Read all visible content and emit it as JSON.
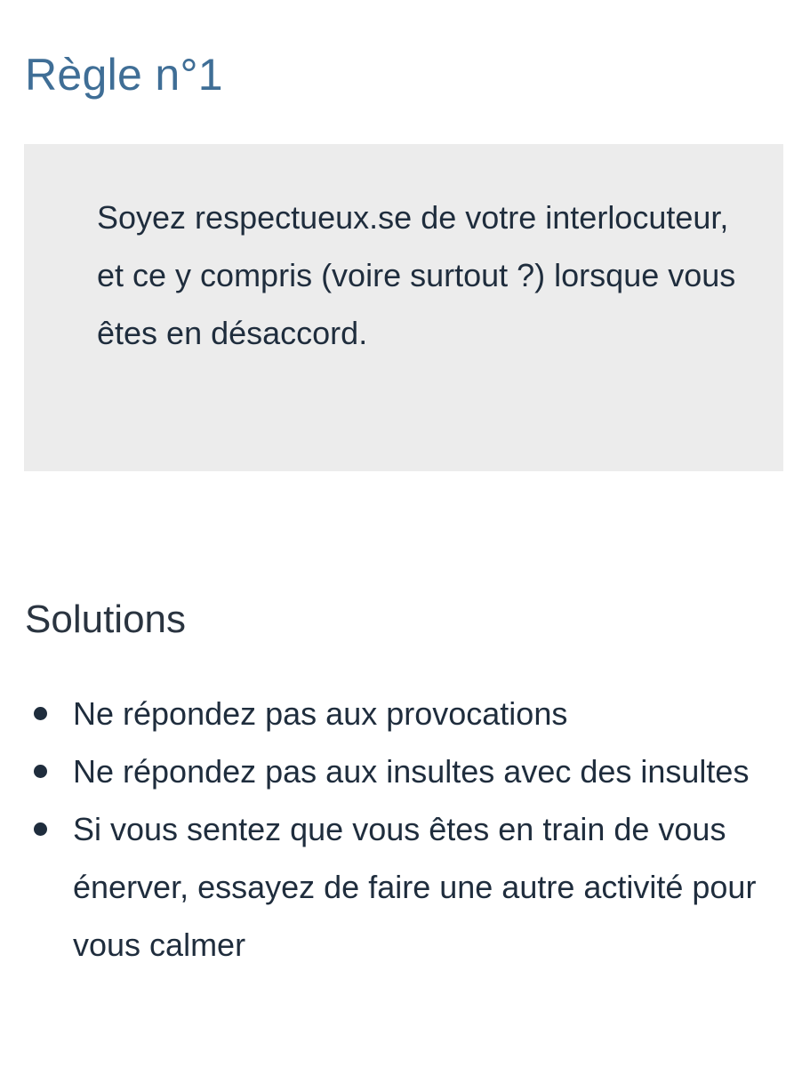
{
  "rule": {
    "title": "Règle n°1",
    "text": "Soyez respectueux.se de votre interlocuteur, et ce y compris (voire surtout ?) lorsque vous êtes en désaccord."
  },
  "solutions": {
    "title": "Solutions",
    "items": [
      "Ne répondez pas aux provocations",
      "Ne répondez pas aux insultes avec des insultes",
      "Si vous sentez que vous êtes en train de vous énerver, essayez de faire une autre activité pour vous calmer"
    ]
  },
  "colors": {
    "heading_accent": "#3f6e96",
    "box_background": "#ececec",
    "text": "#1f2d3d"
  }
}
